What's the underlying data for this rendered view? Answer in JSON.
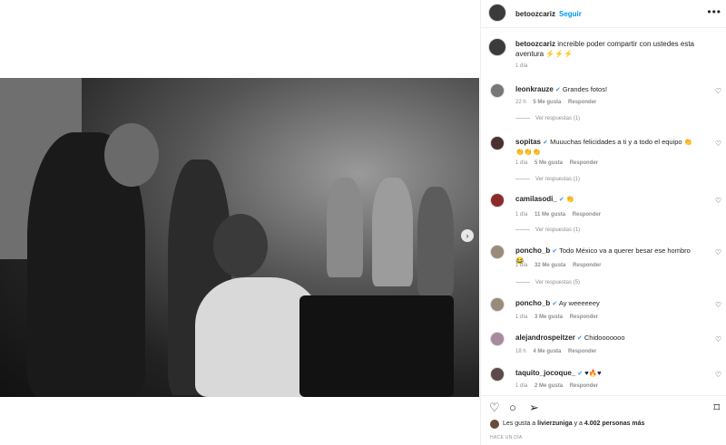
{
  "post": {
    "author": "betoozcariz",
    "follow_label": "Seguir",
    "separator": "•",
    "more": "•••",
    "caption": "increible poder compartir con ustedes esta aventura ⚡⚡⚡",
    "caption_time": "1 día",
    "carousel_next": "›"
  },
  "comments": [
    {
      "user": "leonkrauze",
      "verified": true,
      "text": "Grandes fotos!",
      "time": "22 h",
      "likes": "5 Me gusta",
      "reply": "Responder",
      "replies": "Ver respuestas (1)"
    },
    {
      "user": "sopitas",
      "verified": true,
      "text": "Muuuchas felicidades a ti y a todo el equipo 👏👏👏👏",
      "time": "1 día",
      "likes": "5 Me gusta",
      "reply": "Responder",
      "replies": "Ver respuestas (1)"
    },
    {
      "user": "camilasodi_",
      "verified": true,
      "text": "👏",
      "time": "1 día",
      "likes": "11 Me gusta",
      "reply": "Responder",
      "replies": "Ver respuestas (1)"
    },
    {
      "user": "poncho_b",
      "verified": true,
      "text": "Todo México va a querer besar ese hombro 😂",
      "time": "1 día",
      "likes": "32 Me gusta",
      "reply": "Responder",
      "replies": "Ver respuestas (5)"
    },
    {
      "user": "poncho_b",
      "verified": true,
      "text": "Ay weeeeeey",
      "time": "1 día",
      "likes": "3 Me gusta",
      "reply": "Responder",
      "replies": ""
    },
    {
      "user": "alejandrospeitzer",
      "verified": true,
      "text": "Chidooooooo",
      "time": "18 h",
      "likes": "4 Me gusta",
      "reply": "Responder",
      "replies": ""
    },
    {
      "user": "taquito_jocoque_",
      "verified": true,
      "text": "♥🔥♥",
      "time": "1 día",
      "likes": "2 Me gusta",
      "reply": "Responder",
      "replies": ""
    }
  ],
  "icons": {
    "heart": "♡",
    "comment": "○",
    "share": "➢",
    "save": "⌑"
  },
  "likes_line": {
    "prefix": "Les gusta a ",
    "user": "livierzuniga",
    "middle": " y a ",
    "count": "4.002 personas más"
  },
  "posted": "HACE UN DÍA"
}
